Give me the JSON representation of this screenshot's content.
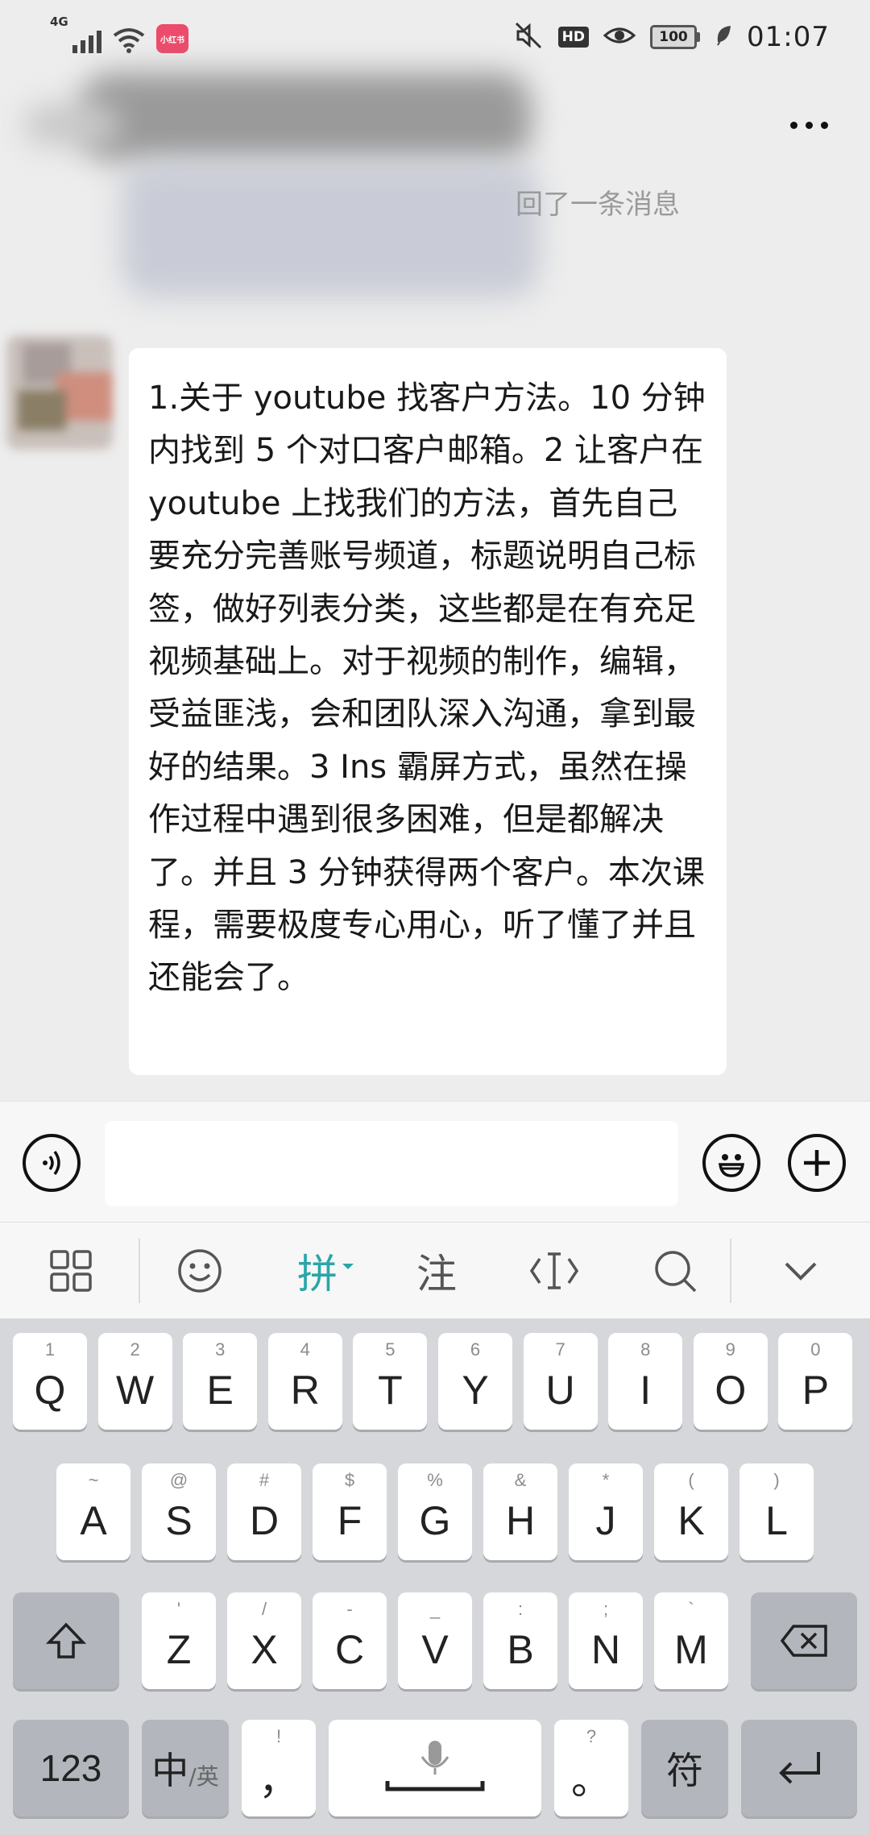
{
  "status_bar": {
    "network": "4G",
    "app_badge": "小红书",
    "hd": "HD",
    "battery": "100",
    "time": "01:07"
  },
  "header": {
    "recall_notice": "回了一条消息"
  },
  "message": {
    "text": "1.关于 youtube 找客户方法。10 分钟内找到 5 个对口客户邮箱。2 让客户在 youtube 上找我们的方法，首先自己要充分完善账号频道，标题说明自己标签，做好列表分类，这些都是在有充足视频基础上。对于视频的制作，编辑，受益匪浅，会和团队深入沟通，拿到最好的结果。3 Ins 霸屏方式，虽然在操作过程中遇到很多困难，但是都解决了。并且 3 分钟获得两个客户。本次课程，需要极度专心用心，听了懂了并且还能会了。"
  },
  "input": {
    "value": ""
  },
  "toolbar": {
    "pinyin": "拼",
    "annotate": "注"
  },
  "keyboard": {
    "row1": [
      {
        "key": "Q",
        "hint": "1"
      },
      {
        "key": "W",
        "hint": "2"
      },
      {
        "key": "E",
        "hint": "3"
      },
      {
        "key": "R",
        "hint": "4"
      },
      {
        "key": "T",
        "hint": "5"
      },
      {
        "key": "Y",
        "hint": "6"
      },
      {
        "key": "U",
        "hint": "7"
      },
      {
        "key": "I",
        "hint": "8"
      },
      {
        "key": "O",
        "hint": "9"
      },
      {
        "key": "P",
        "hint": "0"
      }
    ],
    "row2": [
      {
        "key": "A",
        "hint": "~"
      },
      {
        "key": "S",
        "hint": "@"
      },
      {
        "key": "D",
        "hint": "#"
      },
      {
        "key": "F",
        "hint": "$"
      },
      {
        "key": "G",
        "hint": "%"
      },
      {
        "key": "H",
        "hint": "&"
      },
      {
        "key": "J",
        "hint": "*"
      },
      {
        "key": "K",
        "hint": "("
      },
      {
        "key": "L",
        "hint": ")"
      }
    ],
    "row3": [
      {
        "key": "Z",
        "hint": "'"
      },
      {
        "key": "X",
        "hint": "/"
      },
      {
        "key": "C",
        "hint": "-"
      },
      {
        "key": "V",
        "hint": "_"
      },
      {
        "key": "B",
        "hint": ":"
      },
      {
        "key": "N",
        "hint": ";"
      },
      {
        "key": "M",
        "hint": "`"
      }
    ],
    "num_key": "123",
    "lang_key_main": "中",
    "lang_key_sub": "/英",
    "comma_key": "，",
    "comma_hint": "!",
    "period_key": "。",
    "period_hint": "?",
    "symbol_key": "符"
  }
}
